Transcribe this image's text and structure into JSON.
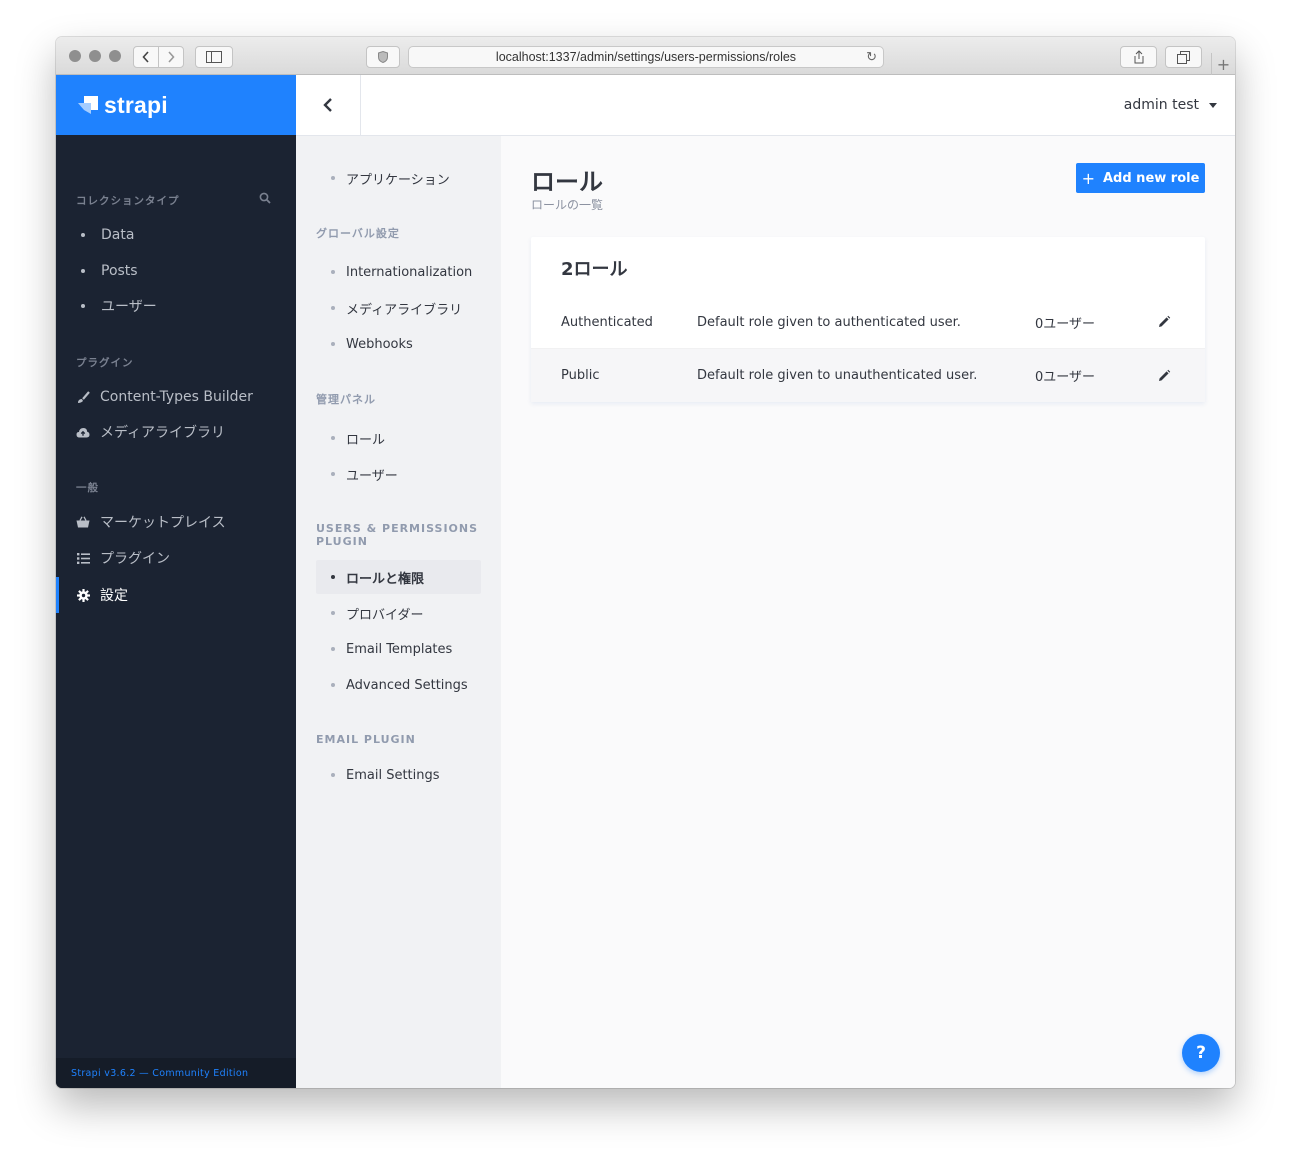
{
  "browser": {
    "url": "localhost:1337/admin/settings/users-permissions/roles"
  },
  "brand": {
    "name": "strapi"
  },
  "leftnav": {
    "collection_heading": "コレクションタイプ",
    "collections": [
      "Data",
      "Posts",
      "ユーザー"
    ],
    "plugins_heading": "プラグイン",
    "plugins": [
      "Content-Types Builder",
      "メディアライブラリ"
    ],
    "general_heading": "一般",
    "general": [
      "マーケットプレイス",
      "プラグイン",
      "設定"
    ],
    "footer": "Strapi v3.6.2 — Community Edition"
  },
  "header": {
    "user_name": "admin test"
  },
  "subnav": {
    "top_item": "アプリケーション",
    "global_heading": "グローバル設定",
    "global_items": [
      "Internationalization",
      "メディアライブラリ",
      "Webhooks"
    ],
    "admin_heading": "管理パネル",
    "admin_items": [
      "ロール",
      "ユーザー"
    ],
    "users_heading": "USERS & PERMISSIONS PLUGIN",
    "users_items": [
      "ロールと権限",
      "プロバイダー",
      "Email Templates",
      "Advanced Settings"
    ],
    "email_heading": "EMAIL PLUGIN",
    "email_items": [
      "Email Settings"
    ]
  },
  "main": {
    "title": "ロール",
    "subtitle": "ロールの一覧",
    "add_button": "Add new role",
    "card_title": "2ロール",
    "roles": [
      {
        "name": "Authenticated",
        "description": "Default role given to authenticated user.",
        "count": "0ユーザー"
      },
      {
        "name": "Public",
        "description": "Default role given to unauthenticated user.",
        "count": "0ユーザー"
      }
    ],
    "help_label": "?"
  },
  "colors": {
    "brand_blue": "#1f82fe",
    "sidebar_dark": "#1b2332",
    "subnav_bg": "#f1f2f4"
  }
}
